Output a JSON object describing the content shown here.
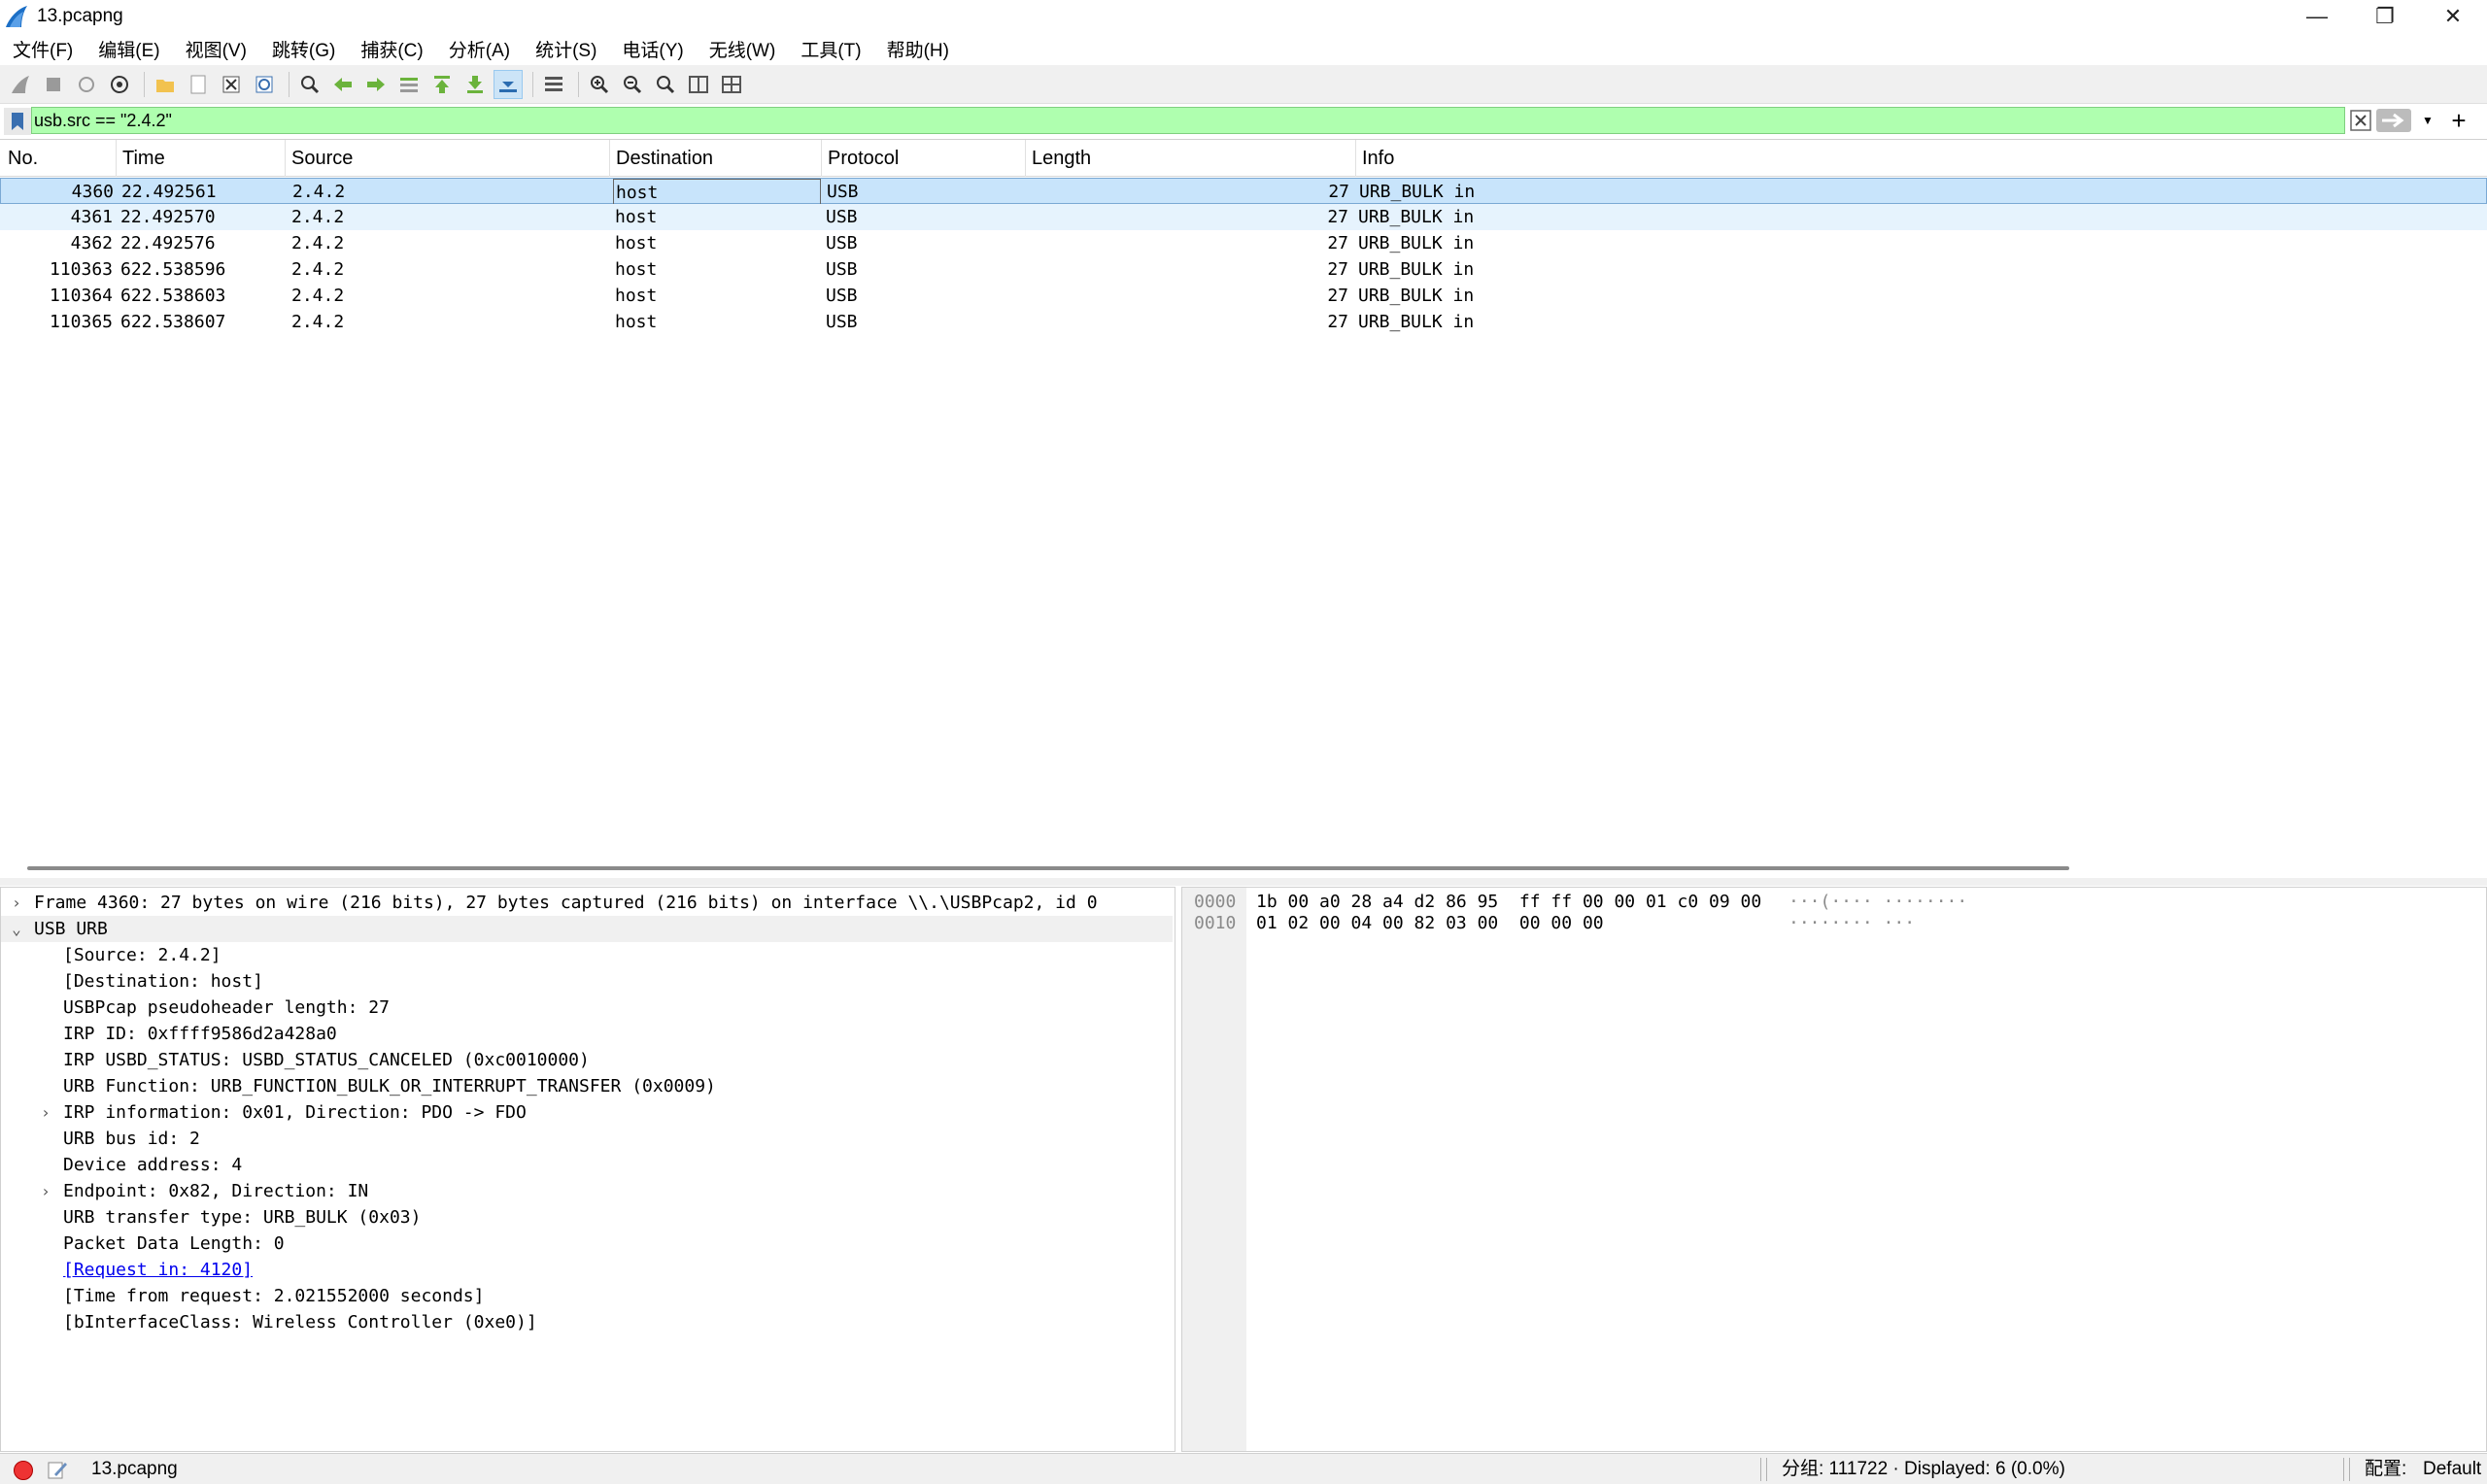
{
  "window": {
    "title": "13.pcapng",
    "minimize": "—",
    "restore": "❐",
    "close": "✕"
  },
  "menu": [
    "文件(F)",
    "编辑(E)",
    "视图(V)",
    "跳转(G)",
    "捕获(C)",
    "分析(A)",
    "统计(S)",
    "电话(Y)",
    "无线(W)",
    "工具(T)",
    "帮助(H)"
  ],
  "toolbar": {
    "icons": [
      "shark-fin-start-icon",
      "stop-capture-icon",
      "restart-capture-icon",
      "capture-options-icon",
      "open-file-icon",
      "save-file-icon",
      "close-file-icon",
      "reload-file-icon",
      "find-packet-icon",
      "go-back-icon",
      "go-forward-icon",
      "go-to-packet-icon",
      "first-packet-icon",
      "last-packet-icon",
      "auto-scroll-icon",
      "colorize-icon",
      "zoom-in-icon",
      "zoom-out-icon",
      "normal-size-icon",
      "resize-columns-icon",
      "layout-icon"
    ]
  },
  "filter": {
    "value": "usb.src == \"2.4.2\"",
    "bg_color": "#afffaf"
  },
  "packet_list": {
    "columns": [
      "No.",
      "Time",
      "Source",
      "Destination",
      "Protocol",
      "Length",
      "Info"
    ],
    "rows": [
      {
        "no": "4360",
        "time": "22.492561",
        "source": "2.4.2",
        "destination": "host",
        "protocol": "USB",
        "length": "27",
        "info": "URB_BULK in"
      },
      {
        "no": "4361",
        "time": "22.492570",
        "source": "2.4.2",
        "destination": "host",
        "protocol": "USB",
        "length": "27",
        "info": "URB_BULK in"
      },
      {
        "no": "4362",
        "time": "22.492576",
        "source": "2.4.2",
        "destination": "host",
        "protocol": "USB",
        "length": "27",
        "info": "URB_BULK in"
      },
      {
        "no": "110363",
        "time": "622.538596",
        "source": "2.4.2",
        "destination": "host",
        "protocol": "USB",
        "length": "27",
        "info": "URB_BULK in"
      },
      {
        "no": "110364",
        "time": "622.538603",
        "source": "2.4.2",
        "destination": "host",
        "protocol": "USB",
        "length": "27",
        "info": "URB_BULK in"
      },
      {
        "no": "110365",
        "time": "622.538607",
        "source": "2.4.2",
        "destination": "host",
        "protocol": "USB",
        "length": "27",
        "info": "URB_BULK in"
      }
    ],
    "selected_color": "#c8e4fb"
  },
  "details": {
    "lines": [
      {
        "indent": 0,
        "arrow": "›",
        "text": "Frame 4360: 27 bytes on wire (216 bits), 27 bytes captured (216 bits) on interface \\\\.\\USBPcap2, id 0"
      },
      {
        "indent": 0,
        "arrow": "⌄",
        "text": "USB URB"
      },
      {
        "indent": 1,
        "arrow": "",
        "text": "[Source: 2.4.2]"
      },
      {
        "indent": 1,
        "arrow": "",
        "text": "[Destination: host]"
      },
      {
        "indent": 1,
        "arrow": "",
        "text": "USBPcap pseudoheader length: 27"
      },
      {
        "indent": 1,
        "arrow": "",
        "text": "IRP ID: 0xffff9586d2a428a0"
      },
      {
        "indent": 1,
        "arrow": "",
        "text": "IRP USBD_STATUS: USBD_STATUS_CANCELED (0xc0010000)"
      },
      {
        "indent": 1,
        "arrow": "",
        "text": "URB Function: URB_FUNCTION_BULK_OR_INTERRUPT_TRANSFER (0x0009)"
      },
      {
        "indent": 1,
        "arrow": "›",
        "text": "IRP information: 0x01, Direction: PDO -> FDO"
      },
      {
        "indent": 1,
        "arrow": "",
        "text": "URB bus id: 2"
      },
      {
        "indent": 1,
        "arrow": "",
        "text": "Device address: 4"
      },
      {
        "indent": 1,
        "arrow": "›",
        "text": "Endpoint: 0x82, Direction: IN"
      },
      {
        "indent": 1,
        "arrow": "",
        "text": "URB transfer type: URB_BULK (0x03)"
      },
      {
        "indent": 1,
        "arrow": "",
        "text": "Packet Data Length: 0"
      },
      {
        "indent": 1,
        "arrow": "",
        "text": "[Request in: 4120]",
        "link": true
      },
      {
        "indent": 1,
        "arrow": "",
        "text": "[Time from request: 2.021552000 seconds]"
      },
      {
        "indent": 1,
        "arrow": "",
        "text": "[bInterfaceClass: Wireless Controller (0xe0)]"
      }
    ]
  },
  "bytes": {
    "lines": [
      {
        "offset": "0000",
        "hex": "1b 00 a0 28 a4 d2 86 95  ff ff 00 00 01 c0 09 00",
        "ascii": "···(···· ········"
      },
      {
        "offset": "0010",
        "hex": "01 02 00 04 00 82 03 00  00 00 00",
        "ascii": "········ ···"
      }
    ]
  },
  "status": {
    "file": "13.pcapng",
    "packets": "分组: 111722 · Displayed: 6 (0.0%)",
    "profile_label": "配置:",
    "profile": "Default"
  }
}
